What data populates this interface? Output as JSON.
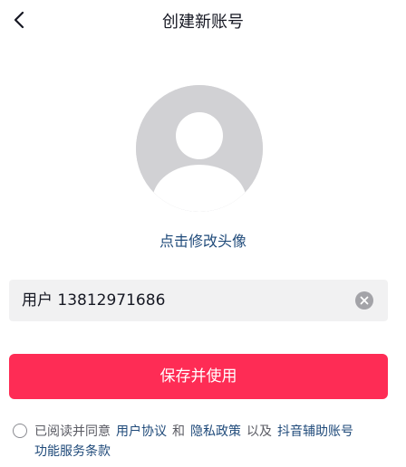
{
  "header": {
    "back_icon": "chevron-left-icon",
    "title": "创建新账号"
  },
  "avatar": {
    "icon": "default-avatar-icon",
    "change_label": "点击修改头像"
  },
  "username_field": {
    "value": "用户 13812971686",
    "clear_icon": "clear-icon"
  },
  "save_button": {
    "label": "保存并使用"
  },
  "agreement": {
    "prefix": "已阅读并同意",
    "user_agreement": "用户协议",
    "and": "和",
    "privacy_policy": "隐私政策",
    "also": "以及",
    "aux_account_terms_part1": "抖音辅助账号",
    "aux_account_terms_part2": "功能服务条款"
  },
  "colors": {
    "brand_red": "#fe2c55",
    "link_blue": "#1f4a7a",
    "avatar_gray": "#d1d1d4"
  }
}
